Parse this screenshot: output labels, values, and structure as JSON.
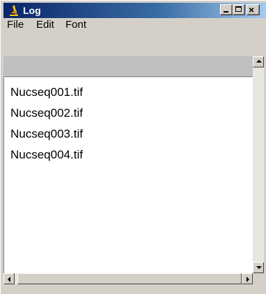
{
  "window": {
    "title": "Log",
    "icon": "microscope-icon"
  },
  "menu": {
    "items": [
      "File",
      "Edit",
      "Font"
    ]
  },
  "log": {
    "lines": [
      "Nucseq001.tif",
      "Nucseq002.tif",
      "Nucseq003.tif",
      "Nucseq004.tif"
    ]
  },
  "colors": {
    "titlebar_start": "#0a246a",
    "titlebar_end": "#a6caf0",
    "chrome": "#d4d0c8"
  }
}
